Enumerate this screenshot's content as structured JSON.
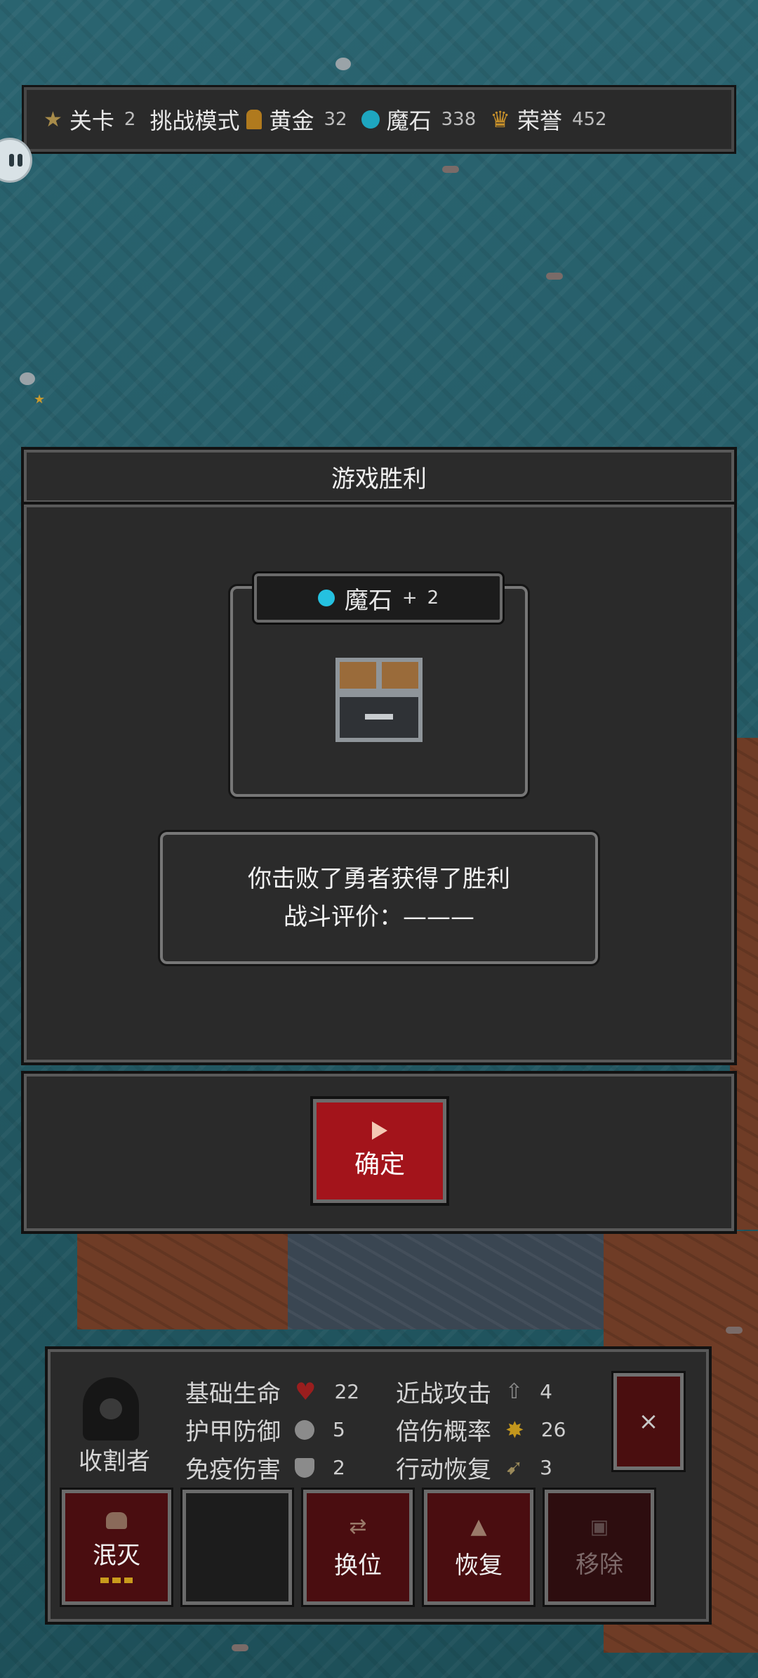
{
  "top_bar": {
    "level_label": "关卡",
    "level_value": "2",
    "mode_label": "挑战模式",
    "gold_label": "黄金",
    "gold_value": "32",
    "magic_stone_label": "魔石",
    "magic_stone_value": "338",
    "honor_label": "荣誉",
    "honor_value": "452"
  },
  "victory_dialog": {
    "title": "游戏胜利",
    "reward_name": "魔石",
    "reward_plus": "+",
    "reward_amount": "2",
    "message_line1": "你击败了勇者获得了胜利",
    "message_line2": "战斗评价：———",
    "confirm_label": "确定"
  },
  "unit_panel": {
    "unit_name": "收割者",
    "stats": [
      {
        "label": "基础生命",
        "icon": "heart-icon",
        "value": "22"
      },
      {
        "label": "近战攻击",
        "icon": "attack-icon",
        "value": "4"
      },
      {
        "label": "护甲防御",
        "icon": "armor-icon",
        "value": "5"
      },
      {
        "label": "倍伤概率",
        "icon": "crit-icon",
        "value": "26"
      },
      {
        "label": "免疫伤害",
        "icon": "immune-shield-icon",
        "value": "2"
      },
      {
        "label": "行动恢复",
        "icon": "action-icon",
        "value": "3"
      }
    ],
    "actions": {
      "annihilate": "泯灭",
      "swap": "换位",
      "recover": "恢复",
      "remove": "移除"
    },
    "close_icon": "×"
  },
  "colors": {
    "panel_bg": "#2a2a2a",
    "confirm_red": "#a3141b",
    "water": "#245a64",
    "gem": "#25c1e0",
    "gold": "#c99b1c"
  }
}
